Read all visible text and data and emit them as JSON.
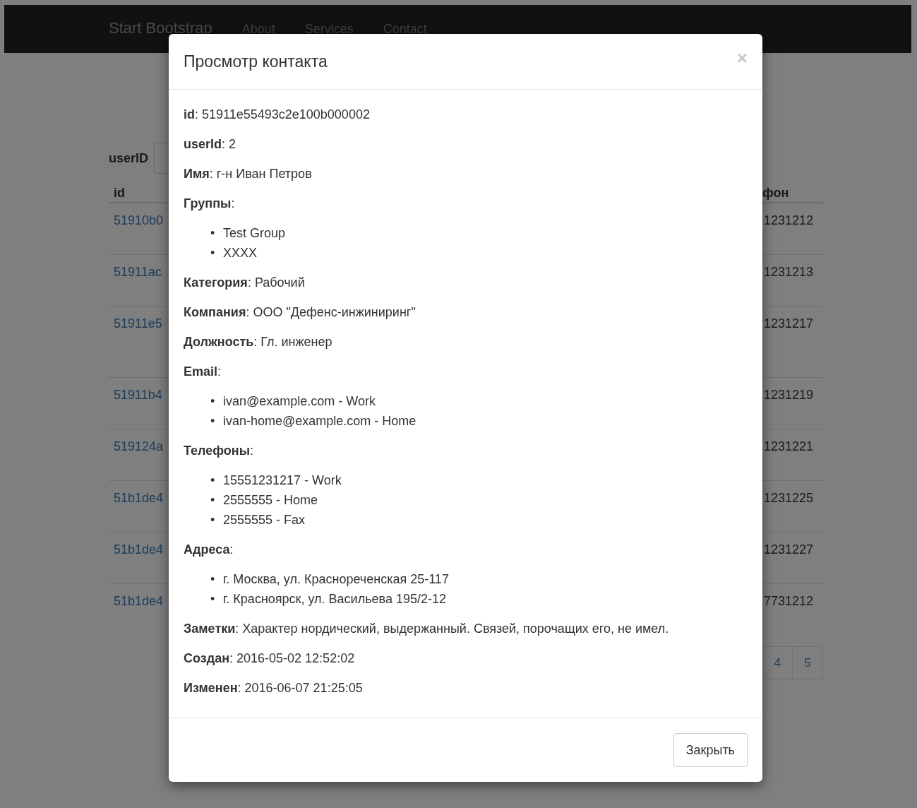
{
  "navbar": {
    "brand": "Start Bootstrap",
    "links": [
      "About",
      "Services",
      "Contact"
    ]
  },
  "filter": {
    "label": "userID"
  },
  "table": {
    "column_1": "id",
    "column_last": "фон",
    "rows": [
      {
        "column_1": "51910b0",
        "column_last": "1231212"
      },
      {
        "column_1": "51911ac",
        "column_last": "1231213"
      },
      {
        "column_1": "51911e5",
        "column_last": "1231217"
      },
      {
        "column_1": "51911b4",
        "column_last": "1231219"
      },
      {
        "column_1": "519124a",
        "column_last": "1231221"
      },
      {
        "column_1": "51b1de4",
        "column_last": "1231225"
      },
      {
        "column_1": "51b1de4",
        "column_last": "1231227"
      },
      {
        "column_1": "51b1de4",
        "column_last": "7731212"
      }
    ]
  },
  "pagination": [
    "4",
    "5"
  ],
  "modal": {
    "title": "Просмотр контакта",
    "close": "×",
    "fields": [
      {
        "kind": "text",
        "text": "**id**: 51911e55493c2e100b000002"
      },
      {
        "kind": "text",
        "text": "**userId**: 2"
      },
      {
        "kind": "text",
        "text": "**Имя**: г-н Иван Петров"
      },
      {
        "kind": "list",
        "text": "**Группы**:",
        "marker": "•",
        "items": [
          "Test Group",
          "XXXX"
        ]
      },
      {
        "kind": "text",
        "text": "**Категория**: Рабочий"
      },
      {
        "kind": "text",
        "text": "**Компания**: ООО \"Дефенс-инжиниринг\""
      },
      {
        "kind": "text",
        "text": "**Должность**: Гл. инженер"
      },
      {
        "kind": "list",
        "text": "**Email**:",
        "marker": "•",
        "items": [
          "ivan@example.com - Work",
          "ivan-home@example.com - Home"
        ]
      },
      {
        "kind": "list",
        "text": "**Телефоны**:",
        "marker": "•",
        "items": [
          "15551231217 - Work",
          "2555555 - Home",
          "2555555 - Fax"
        ]
      },
      {
        "kind": "list",
        "text": "**Адреса**:",
        "marker": "•",
        "items": [
          "г. Москва, ул. Краснореченская 25-117",
          "г. Красноярск, ул. Васильева 195/2-12"
        ]
      },
      {
        "kind": "text",
        "text": "**Заметки**: Характер нордический, выдержанный. Связей, порочащих его, не имел."
      },
      {
        "kind": "text",
        "text": "**Создан**: 2016-05-02 12:52:02"
      },
      {
        "kind": "text",
        "text": "**Изменен**: 2016-06-07 21:25:05"
      }
    ],
    "button": "Закрыть"
  }
}
